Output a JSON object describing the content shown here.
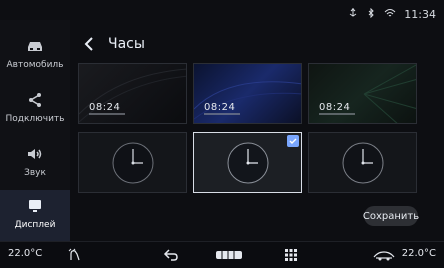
{
  "status": {
    "time": "11:34"
  },
  "sidebar": {
    "items": [
      {
        "label": "Автомобиль",
        "icon": "car-icon"
      },
      {
        "label": "Подключить",
        "icon": "share-icon"
      },
      {
        "label": "Звук",
        "icon": "sound-icon"
      },
      {
        "label": "Дисплей",
        "icon": "display-icon"
      }
    ]
  },
  "page": {
    "title": "Часы"
  },
  "cards": [
    {
      "time": "08:24",
      "style": "digital"
    },
    {
      "time": "08:24",
      "style": "digital"
    },
    {
      "time": "08:24",
      "style": "digital"
    },
    {
      "style": "analog"
    },
    {
      "style": "analog",
      "selected": true
    },
    {
      "style": "analog"
    }
  ],
  "actions": {
    "save_label": "Сохранить"
  },
  "bottom": {
    "temp_left": "22.0°C",
    "temp_right": "22.0°C"
  }
}
